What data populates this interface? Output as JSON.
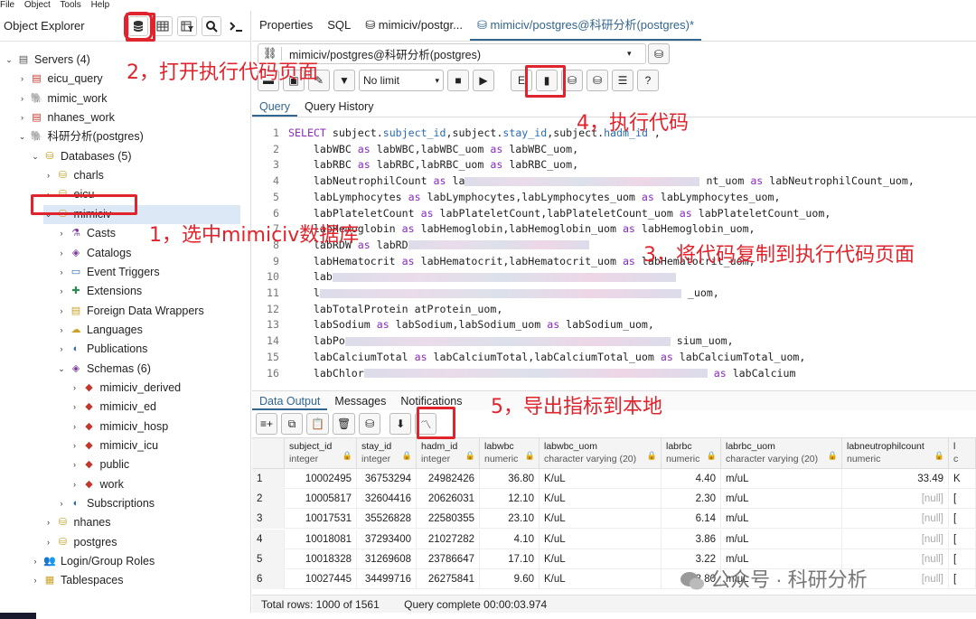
{
  "menubar": [
    "File",
    "Object",
    "Tools",
    "Help"
  ],
  "left": {
    "title": "Object Explorer",
    "tree": [
      {
        "label": "Servers (4)",
        "icon": "servers-icon",
        "depth": 0,
        "chev": "v"
      },
      {
        "label": "eicu_query",
        "icon": "server-icon",
        "depth": 1,
        "chev": ">"
      },
      {
        "label": "mimic_work",
        "icon": "postgres-icon",
        "depth": 1,
        "chev": ">"
      },
      {
        "label": "nhanes_work",
        "icon": "server-icon",
        "depth": 1,
        "chev": ">"
      },
      {
        "label": "科研分析(postgres)",
        "icon": "postgres-icon",
        "depth": 1,
        "chev": "v"
      },
      {
        "label": "Databases (5)",
        "icon": "databases-icon",
        "depth": 2,
        "chev": "v"
      },
      {
        "label": "charls",
        "icon": "database-icon",
        "depth": 3,
        "chev": ">"
      },
      {
        "label": "eicu",
        "icon": "database-icon",
        "depth": 3,
        "chev": ">"
      },
      {
        "label": "mimiciv",
        "icon": "database-icon",
        "depth": 3,
        "chev": "v",
        "selected": true
      },
      {
        "label": "Casts",
        "icon": "casts-icon",
        "depth": 4,
        "chev": ">"
      },
      {
        "label": "Catalogs",
        "icon": "catalogs-icon",
        "depth": 4,
        "chev": ">"
      },
      {
        "label": "Event Triggers",
        "icon": "event-triggers-icon",
        "depth": 4,
        "chev": ">"
      },
      {
        "label": "Extensions",
        "icon": "extensions-icon",
        "depth": 4,
        "chev": ">"
      },
      {
        "label": "Foreign Data Wrappers",
        "icon": "fdw-icon",
        "depth": 4,
        "chev": ">"
      },
      {
        "label": "Languages",
        "icon": "languages-icon",
        "depth": 4,
        "chev": ">"
      },
      {
        "label": "Publications",
        "icon": "publications-icon",
        "depth": 4,
        "chev": ">"
      },
      {
        "label": "Schemas (6)",
        "icon": "schemas-icon",
        "depth": 4,
        "chev": "v"
      },
      {
        "label": "mimiciv_derived",
        "icon": "schema-icon",
        "depth": 5,
        "chev": ">"
      },
      {
        "label": "mimiciv_ed",
        "icon": "schema-icon",
        "depth": 5,
        "chev": ">"
      },
      {
        "label": "mimiciv_hosp",
        "icon": "schema-icon",
        "depth": 5,
        "chev": ">"
      },
      {
        "label": "mimiciv_icu",
        "icon": "schema-icon",
        "depth": 5,
        "chev": ">"
      },
      {
        "label": "public",
        "icon": "schema-icon",
        "depth": 5,
        "chev": ">"
      },
      {
        "label": "work",
        "icon": "schema-icon",
        "depth": 5,
        "chev": ">"
      },
      {
        "label": "Subscriptions",
        "icon": "subscriptions-icon",
        "depth": 4,
        "chev": ">"
      },
      {
        "label": "nhanes",
        "icon": "database-icon",
        "depth": 3,
        "chev": ">"
      },
      {
        "label": "postgres",
        "icon": "database-icon",
        "depth": 3,
        "chev": ">"
      },
      {
        "label": "Login/Group Roles",
        "icon": "roles-icon",
        "depth": 2,
        "chev": ">"
      },
      {
        "label": "Tablespaces",
        "icon": "tablespaces-icon",
        "depth": 2,
        "chev": ">"
      }
    ]
  },
  "tabs": [
    "Properties",
    "SQL",
    "mimiciv/postgr...",
    "mimiciv/postgres@科研分析(postgres)*"
  ],
  "connection": "mimiciv/postgres@科研分析(postgres)",
  "limit": "No limit",
  "query_tabs": [
    "Query",
    "Query History"
  ],
  "code_lines": [
    "SELECT subject.subject_id,subject.stay_id,subject.hadm_id ,",
    "    labWBC as labWBC,labWBC_uom as labWBC_uom,",
    "    labRBC as labRBC,labRBC_uom as labRBC_uom,",
    "    labNeutrophilCount as la",
    "    labLymphocytes as labLymphocytes,labLymphocytes_uom as labLymphocytes_uom,",
    "    labPlateletCount as labPlateletCount,labPlateletCount_uom as labPlateletCount_uom,",
    "    labHemoglobin as labHemoglobin,labHemoglobin_uom as labHemoglobin_uom,",
    "    labRDW as labRD",
    "    labHematocrit as labHematocrit,labHematocrit_uom as labHematocrit_uom,",
    "    lab",
    "    l",
    "    labTotalProtein",
    "    labSodium as labSodium,labSodium_uom as labSodium_uom,",
    "    labPo",
    "    labCalciumTotal as labCalciumTotal,labCalciumTotal_uom as labCalciumTotal_uom,",
    "    labChlor"
  ],
  "code_tails": [
    "",
    "",
    "",
    "nt_uom as labNeutrophilCount_uom,",
    "",
    "",
    "",
    "",
    "",
    "",
    "_uom,",
    "atProtein_uom,",
    "",
    "sium_uom,",
    "",
    "as labCalcium"
  ],
  "output_tabs": [
    "Data Output",
    "Messages",
    "Notifications"
  ],
  "columns": [
    {
      "name": "",
      "type": ""
    },
    {
      "name": "subject_id",
      "type": "integer"
    },
    {
      "name": "stay_id",
      "type": "integer"
    },
    {
      "name": "hadm_id",
      "type": "integer"
    },
    {
      "name": "labwbc",
      "type": "numeric"
    },
    {
      "name": "labwbc_uom",
      "type": "character varying (20)"
    },
    {
      "name": "labrbc",
      "type": "numeric"
    },
    {
      "name": "labrbc_uom",
      "type": "character varying (20)"
    },
    {
      "name": "labneutrophilcount",
      "type": "numeric"
    },
    {
      "name": "l",
      "type": "c"
    }
  ],
  "rows": [
    [
      "1",
      "10002495",
      "36753294",
      "24982426",
      "36.80",
      "K/uL",
      "4.40",
      "m/uL",
      "33.49",
      "K"
    ],
    [
      "2",
      "10005817",
      "32604416",
      "20626031",
      "12.10",
      "K/uL",
      "2.30",
      "m/uL",
      "[null]",
      "["
    ],
    [
      "3",
      "10017531",
      "35526828",
      "22580355",
      "23.10",
      "K/uL",
      "6.14",
      "m/uL",
      "[null]",
      "["
    ],
    [
      "4",
      "10018081",
      "37293400",
      "21027282",
      "4.10",
      "K/uL",
      "3.86",
      "m/uL",
      "[null]",
      "["
    ],
    [
      "5",
      "10018328",
      "31269608",
      "23786647",
      "17.10",
      "K/uL",
      "3.22",
      "m/uL",
      "[null]",
      "["
    ],
    [
      "6",
      "10027445",
      "34499716",
      "26275841",
      "9.60",
      "K/uL",
      "3.80",
      "m/uL",
      "[null]",
      "["
    ]
  ],
  "status": {
    "total_rows": "Total rows: 1000 of 1561",
    "query_complete": "Query complete 00:00:03.974"
  },
  "annotations": {
    "a1": "1，选中mimiciv数据库",
    "a2": "2，打开执行代码页面",
    "a3": "3，将代码复制到执行代码页面",
    "a4": "4，执行代码",
    "a5": "5，导出指标到本地"
  },
  "watermark": "公众号 · 科研分析",
  "colors": {
    "annotation_red": "#e0242d",
    "accent": "#326690"
  }
}
